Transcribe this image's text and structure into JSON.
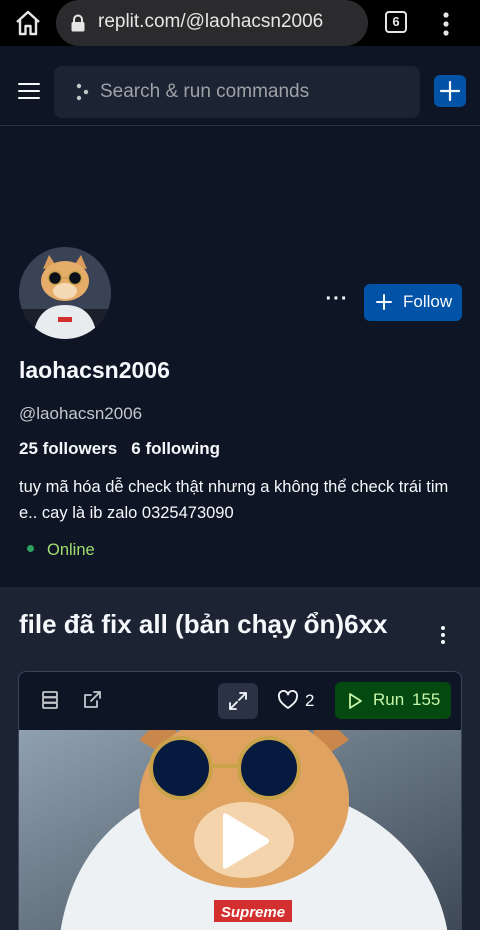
{
  "browser": {
    "url": "replit.com/@laohacsn2006",
    "tab_count": "6"
  },
  "header": {
    "search_placeholder": "Search & run commands"
  },
  "profile": {
    "display_name": "laohacsn2006",
    "handle": "@laohacsn2006",
    "followers": "25 followers",
    "following": "6 following",
    "bio": "tuy mã hóa dễ check thật nhưng a không thể check trái tim e.. cay là ib zalo 0325473090",
    "status": "Online",
    "follow_label": "Follow",
    "more_label": "···"
  },
  "repl": {
    "title": "file đã fix all (bản chạy ổn)6xx",
    "likes": "2",
    "run_label": "Run",
    "run_count": "155",
    "cover_logo_text": "Supreme"
  },
  "colors": {
    "background": "#0e1525",
    "surface": "#1c2333",
    "accent_blue": "#0053a6",
    "run_green": "#044a10",
    "online_green": "#a1dd70"
  }
}
